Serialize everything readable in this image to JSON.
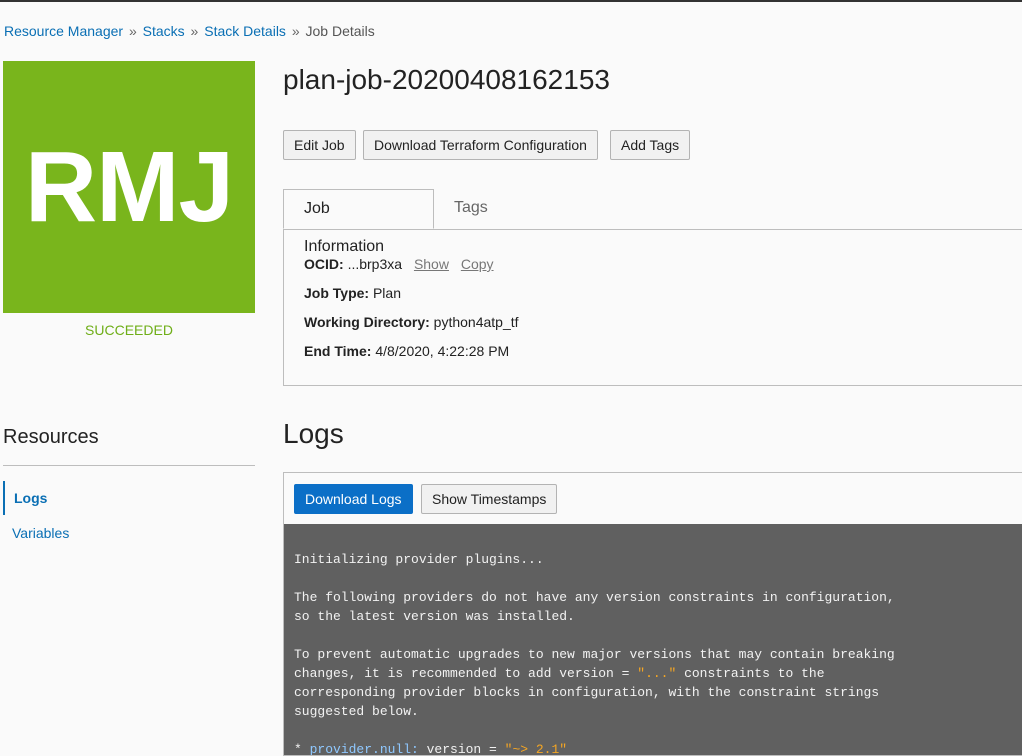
{
  "breadcrumb": {
    "items": [
      "Resource Manager",
      "Stacks",
      "Stack Details"
    ],
    "separator": "»",
    "current": "Job Details"
  },
  "badge": {
    "initials": "RMJ",
    "color": "#79b51c",
    "status": "SUCCEEDED"
  },
  "job": {
    "title": "plan-job-20200408162153",
    "buttons": {
      "edit": "Edit Job",
      "download_config": "Download Terraform Configuration",
      "add_tags": "Add Tags"
    },
    "tabs": {
      "info": "Job Information",
      "tags": "Tags"
    },
    "info": {
      "ocid_label": "OCID:",
      "ocid_value": "...brp3xa",
      "show": "Show",
      "copy": "Copy",
      "type_label": "Job Type:",
      "type_value": "Plan",
      "dir_label": "Working Directory:",
      "dir_value": "python4atp_tf",
      "end_label": "End Time:",
      "end_value": "4/8/2020, 4:22:28 PM"
    }
  },
  "resources": {
    "title": "Resources",
    "items": [
      {
        "label": "Logs",
        "active": true
      },
      {
        "label": "Variables",
        "active": false
      }
    ]
  },
  "logs": {
    "title": "Logs",
    "download": "Download Logs",
    "timestamps": "Show Timestamps",
    "lines": {
      "l1": "Initializing provider plugins...",
      "l2": "",
      "l3": "The following providers do not have any version constraints in configuration,",
      "l4": "so the latest version was installed.",
      "l5": "",
      "l6": "To prevent automatic upgrades to new major versions that may contain breaking",
      "l7a": "changes, it is recommended to add version = ",
      "l7q": "\"...\"",
      "l7b": " constraints to the",
      "l8": "corresponding provider blocks in configuration, with the constraint strings",
      "l9": "suggested below.",
      "l10": "",
      "l11a": "* ",
      "l11k": "provider.null:",
      "l11b": " version = ",
      "l11q": "\"~> 2.1\""
    }
  }
}
